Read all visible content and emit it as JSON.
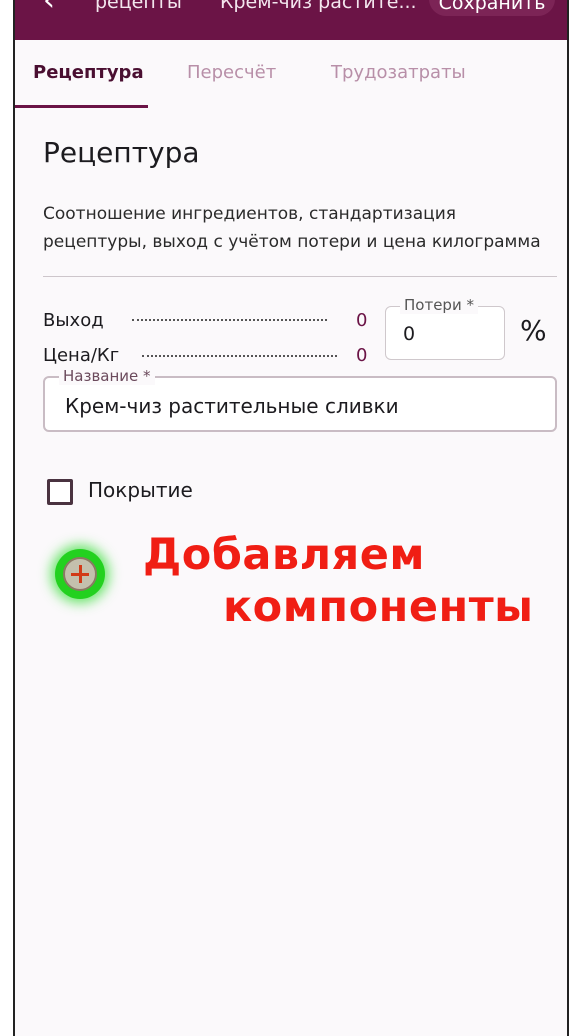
{
  "appbar": {
    "back_icon": "arrow-left-icon",
    "crumb_1": "рецепты",
    "crumb_2": "Крем-чиз растите...",
    "save_label": "Сохранить",
    "color": "#6b1446"
  },
  "tabs": [
    {
      "label": "Рецептура",
      "active": true
    },
    {
      "label": "Пересчёт",
      "active": false
    },
    {
      "label": "Трудозатраты",
      "active": false
    }
  ],
  "section": {
    "title": "Рецептура",
    "description": "Соотношение ингредиентов, стандартизация рецептуры, выход с учётом потери и цена килограмма"
  },
  "yield": {
    "label": "Выход",
    "value": "0"
  },
  "price": {
    "label": "Цена/Кг",
    "value": "0"
  },
  "losses": {
    "label": "Потери *",
    "value": "0",
    "unit": "%"
  },
  "name_field": {
    "label": "Название *",
    "value": "Крем-чиз растительные сливки"
  },
  "coating": {
    "label": "Покрытие",
    "checked": false
  },
  "add_button": {
    "icon": "plus-circle-icon"
  },
  "promo": {
    "line1": "Добавляем",
    "line2": "компоненты",
    "color": "#f01e14"
  }
}
